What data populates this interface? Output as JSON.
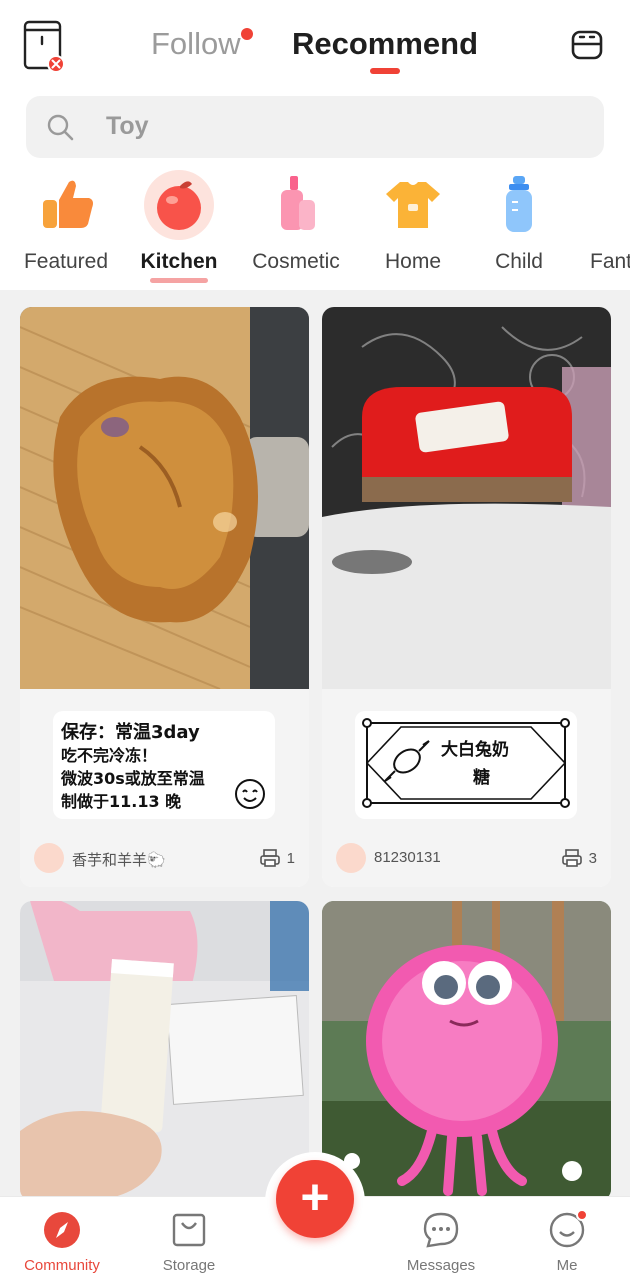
{
  "header": {
    "tabs": [
      {
        "label": "Follow",
        "has_dot": true
      },
      {
        "label": "Recommend",
        "active": true
      }
    ]
  },
  "search": {
    "placeholder": "Toy",
    "icon": "search-icon"
  },
  "categories": [
    {
      "label": "Featured",
      "icon": "thumbs-up-icon"
    },
    {
      "label": "Kitchen",
      "icon": "apple-icon",
      "active": true
    },
    {
      "label": "Cosmetic",
      "icon": "cosmetics-icon"
    },
    {
      "label": "Home",
      "icon": "tshirt-icon"
    },
    {
      "label": "Child",
      "icon": "baby-bottle-icon"
    },
    {
      "label": "Fant",
      "icon": "fantasy-icon"
    }
  ],
  "feed": [
    {
      "photo": "roasted-bread-photo",
      "sticker_lines": [
        "保存：常温3day",
        "吃不完冷冻！",
        "微波30s或放至常温",
        "制做于11.13 晚"
      ],
      "author": "香芋和羊羊🐑",
      "prints": "1"
    },
    {
      "photo": "red-label-printer-photo",
      "sticker_lines": [
        "大白兔奶",
        "糖"
      ],
      "author": "81230131",
      "prints": "3"
    },
    {
      "photo": "cream-tube-photo"
    },
    {
      "photo": "pink-fluffy-monster-photo"
    }
  ],
  "bottom_nav": [
    {
      "label": "Community",
      "icon": "compass-icon",
      "active": true
    },
    {
      "label": "Storage",
      "icon": "bag-icon"
    },
    {
      "label": "Messages",
      "icon": "chat-icon"
    },
    {
      "label": "Me",
      "icon": "smiley-icon",
      "has_dot": true
    }
  ],
  "colors": {
    "accent": "#f04236",
    "background": "#f1f1f1",
    "inactive_text": "#9b9b9b"
  }
}
